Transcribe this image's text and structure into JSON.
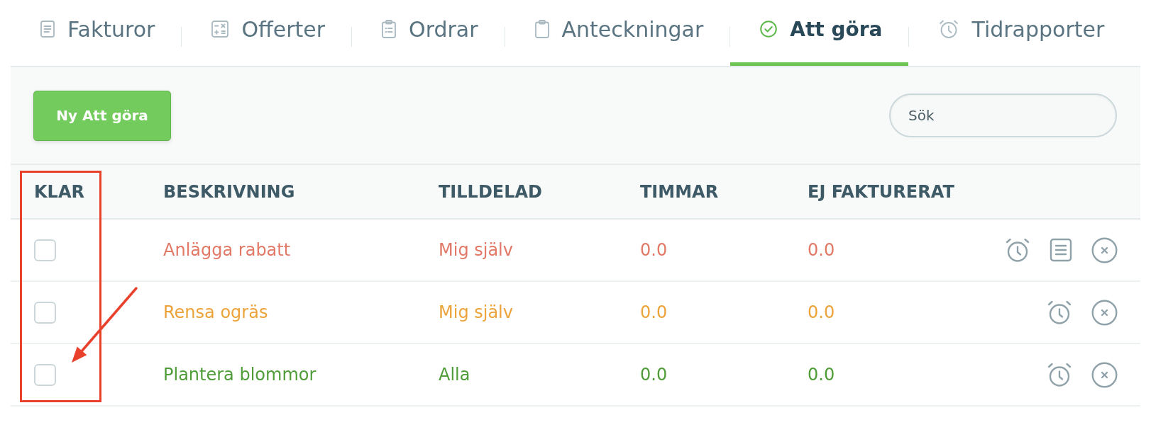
{
  "tabs": [
    {
      "label": "Fakturor",
      "kind": "invoices",
      "selected": false
    },
    {
      "label": "Offerter",
      "kind": "quotes",
      "selected": false
    },
    {
      "label": "Ordrar",
      "kind": "orders",
      "selected": false
    },
    {
      "label": "Anteckningar",
      "kind": "notes",
      "selected": false
    },
    {
      "label": "Att göra",
      "kind": "todo",
      "selected": true
    },
    {
      "label": "Tidrapporter",
      "kind": "time",
      "selected": false
    }
  ],
  "toolbar": {
    "new_button": "Ny Att göra",
    "search": {
      "placeholder": "Sök"
    }
  },
  "table": {
    "columns": [
      "KLAR",
      "BESKRIVNING",
      "TILLDELAD",
      "TIMMAR",
      "EJ FAKTURERAT"
    ],
    "rows": [
      {
        "checked": false,
        "description": "Anlägga rabatt",
        "assigned": "Mig själv",
        "hours": "0.0",
        "unbilled": "0.0",
        "color": "#e27866",
        "has_note": true
      },
      {
        "checked": false,
        "description": "Rensa ogräs",
        "assigned": "Mig själv",
        "hours": "0.0",
        "unbilled": "0.0",
        "color": "#eca33a",
        "has_note": false
      },
      {
        "checked": false,
        "description": "Plantera blommor",
        "assigned": "Alla",
        "hours": "0.0",
        "unbilled": "0.0",
        "color": "#4f9c39",
        "has_note": false
      }
    ]
  },
  "annotation": {
    "frame": true,
    "arrow": true
  }
}
